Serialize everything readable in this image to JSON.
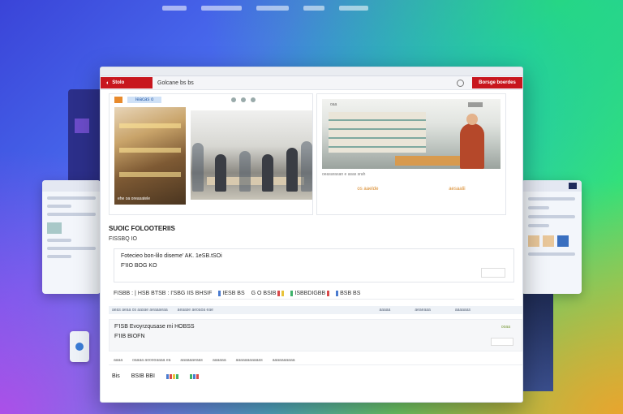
{
  "toolbar": {
    "logo_label": "Stolo",
    "breadcrumb": "Golcane bs bs",
    "cta_label": "Borsge boerdes"
  },
  "hero": {
    "tab_label": "ieacas o",
    "photo_a_caption": "ehe oa oreasatele",
    "photo_c_label": "oaa",
    "meta_text": "oeasarasan e asas srah",
    "pills": [
      "os aaelde",
      "aesaalii"
    ]
  },
  "section": {
    "title": "SUOIC FOLOOTERIIS",
    "subtitle": "FISSBQ IO"
  },
  "card1": {
    "line1": "Fotecieo bon-lilo diseme' AK. 1eSB.tSOi",
    "line2": "F'IIO BOG KO"
  },
  "filters": {
    "g1": "FISBB : | HSB BTSB : I'SBG IIS BHSIF",
    "g2": "IESB BS",
    "g3": "G O BSIB",
    "g4": "ISBBDIGBB",
    "g5": "BSB BS"
  },
  "table_head": {
    "c1": "aeas aeaa os aasae aeaaaeaa",
    "c2": "aeaase aeoaoa eae",
    "c3": "aaaaa",
    "c4": "aeaeaaa",
    "c5": "aaaaaas"
  },
  "row": {
    "line1": "F'ISB Evoyrzqusase mi HOBSS",
    "line2": "F'IIB BIOFN",
    "tag": "ooaa"
  },
  "row_meta": [
    "aaaa",
    "oaaaa aooooaaaa ea",
    "aaaaaaeaas",
    "aaaaaa",
    "aaaaaaaaaaas",
    "aaaaaaaaaa"
  ],
  "bottom": {
    "label": "Bis",
    "label2": "BSIB BBI"
  },
  "colors": {
    "brand_red": "#c8161e",
    "accent_orange": "#d98a2b",
    "tab_blue": "#cfe1f7"
  }
}
